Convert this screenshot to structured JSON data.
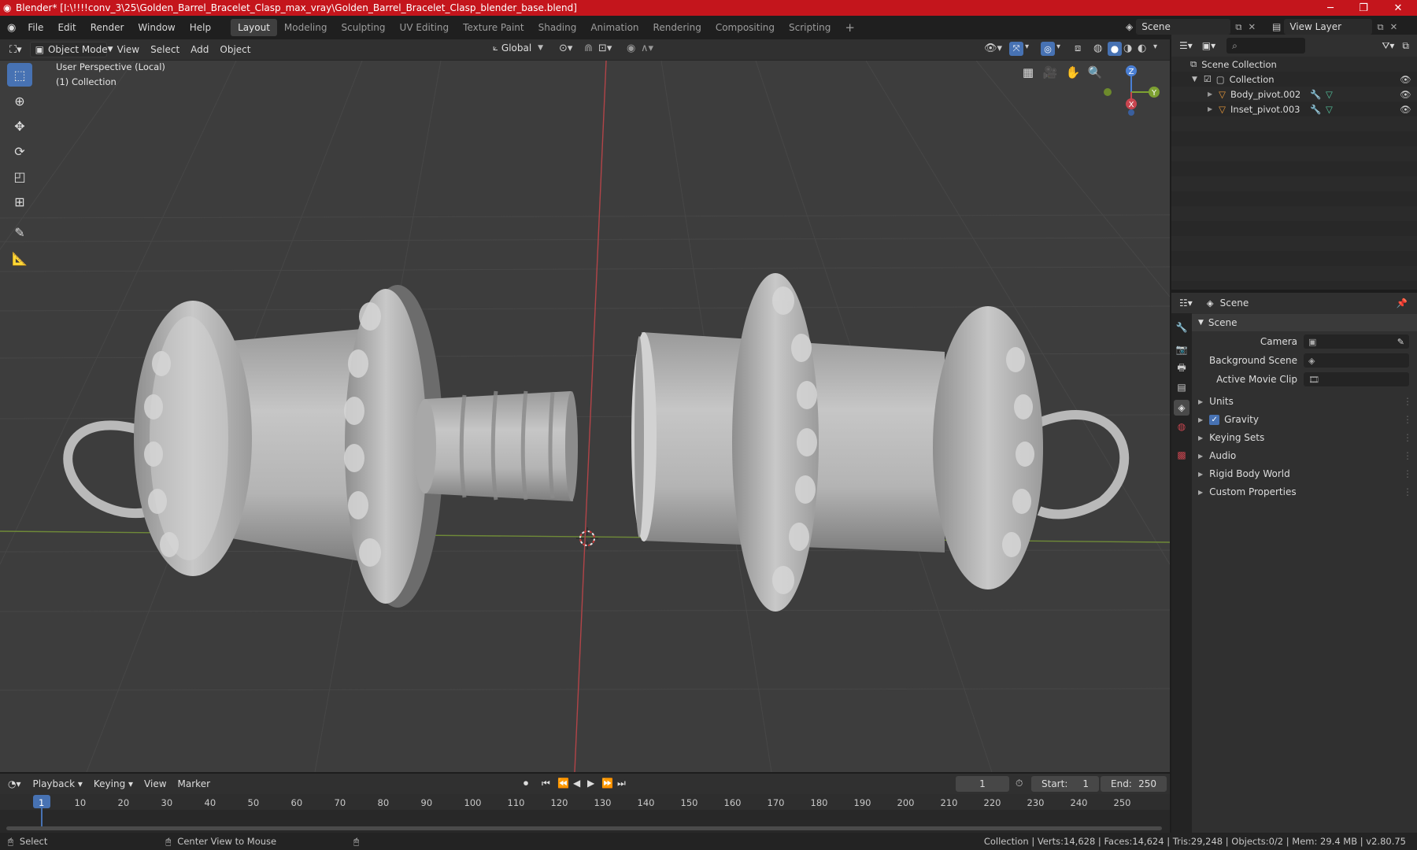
{
  "window": {
    "title": "Blender* [I:\\!!!!conv_3\\25\\Golden_Barrel_Bracelet_Clasp_max_vray\\Golden_Barrel_Bracelet_Clasp_blender_base.blend]"
  },
  "menus": [
    "File",
    "Edit",
    "Render",
    "Window",
    "Help"
  ],
  "workspaces": [
    "Layout",
    "Modeling",
    "Sculpting",
    "UV Editing",
    "Texture Paint",
    "Shading",
    "Animation",
    "Rendering",
    "Compositing",
    "Scripting"
  ],
  "scene_selector": "Scene",
  "view_layer_selector": "View Layer",
  "viewport_header": {
    "mode": "Object Mode",
    "menus": [
      "View",
      "Select",
      "Add",
      "Object"
    ],
    "transform_orientation": "Global"
  },
  "viewport": {
    "view_name": "User Perspective (Local)",
    "collection_label": "(1) Collection",
    "gizmo": {
      "z": "Z",
      "y": "Y",
      "x": "X"
    }
  },
  "outliner": {
    "root": "Scene Collection",
    "collection": "Collection",
    "objects": [
      "Body_pivot.002",
      "Inset_pivot.003"
    ]
  },
  "properties": {
    "context": "Scene",
    "section": "Scene",
    "fields": [
      {
        "label": "Camera",
        "value": ""
      },
      {
        "label": "Background Scene",
        "value": ""
      },
      {
        "label": "Active Movie Clip",
        "value": ""
      }
    ],
    "panels": [
      "Units",
      "Gravity",
      "Keying Sets",
      "Audio",
      "Rigid Body World",
      "Custom Properties"
    ],
    "gravity_enabled": true
  },
  "timeline": {
    "menus": [
      "Playback",
      "Keying",
      "View",
      "Marker"
    ],
    "current_frame": "1",
    "start_label": "Start:",
    "start": "1",
    "end_label": "End:",
    "end": "250",
    "ruler": [
      "1",
      "10",
      "20",
      "30",
      "40",
      "50",
      "60",
      "70",
      "80",
      "90",
      "100",
      "110",
      "120",
      "130",
      "140",
      "150",
      "160",
      "170",
      "180",
      "190",
      "200",
      "210",
      "220",
      "230",
      "240",
      "250"
    ]
  },
  "statusbar": {
    "left_action": "Select",
    "middle_action": "Center View to Mouse",
    "stats": "Collection | Verts:14,628 | Faces:14,624 | Tris:29,248 | Objects:0/2 | Mem: 29.4 MB | v2.80.75"
  },
  "colors": {
    "title_bar": "#c4151c",
    "accent": "#4772b3",
    "viewport_bg": "#3d3d3d",
    "axis_x": "#c8454f",
    "axis_y": "#7da132",
    "axis_z": "#4a7fd4"
  }
}
